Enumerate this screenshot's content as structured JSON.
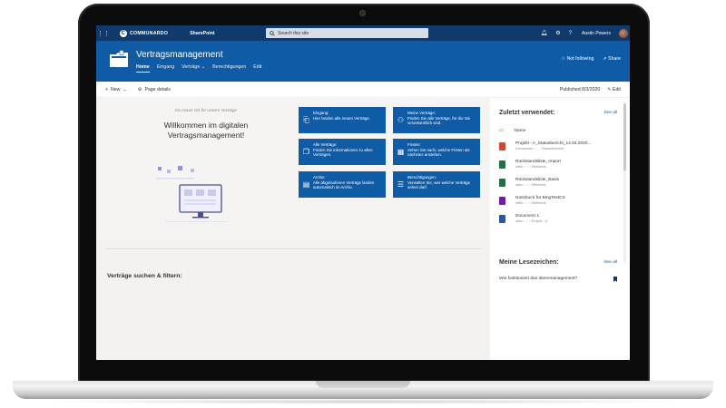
{
  "suitebar": {
    "brand": "COMMUNARDO",
    "product": "SharePoint",
    "search_placeholder": "Search this site",
    "user_name": "Austin Powers",
    "waffle_icon": "waffle-icon",
    "bell_icon": "bell-icon",
    "gear_icon": "gear-icon",
    "help_icon": "help-icon"
  },
  "site": {
    "title": "Vertragsmanagement",
    "nav": [
      {
        "label": "Home",
        "active": true
      },
      {
        "label": "Eingang",
        "active": false
      },
      {
        "label": "Verträge",
        "active": false,
        "dropdown": true
      },
      {
        "label": "Berechtigungen",
        "active": false
      },
      {
        "label": "Edit",
        "active": false
      }
    ],
    "not_following": "Not following",
    "share": "Share"
  },
  "commandbar": {
    "new_label": "New",
    "page_details": "Page details",
    "published": "Published 8/3/2020",
    "edit": "Edit"
  },
  "hero": {
    "subtitle": "Ein neuer Ort für unsere Verträge",
    "title": "Willkommen im digitalen Vertragsmanagement!"
  },
  "tiles": [
    {
      "icon": "inbox-icon",
      "title": "Eingang:",
      "text": "Hier landen alle neuen Verträge."
    },
    {
      "icon": "person-icon",
      "title": "Meine Verträge:",
      "text": "Finden Sie alle Verträge, für die Sie verantwortlich sind."
    },
    {
      "icon": "documents-icon",
      "title": "Alle Verträge:",
      "text": "Finden Sie Informationen zu allen Verträgen."
    },
    {
      "icon": "calendar-icon",
      "title": "Fristen:",
      "text": "Sehen Sie nach, welche Fristen als nächstes anstehen."
    },
    {
      "icon": "archive-icon",
      "title": "Archiv:",
      "text": "Alle abgelaufenen Verträge landen automatisch im Archiv."
    },
    {
      "icon": "permissions-icon",
      "title": "Berechtigungen:",
      "text": "Verwalten Sie, wer welche Verträge sehen darf."
    }
  ],
  "filter": {
    "title": "Verträge suchen & filtern:"
  },
  "recent": {
    "title": "Zuletzt verwendet:",
    "see_all": "See all",
    "column_name": "Name",
    "files": [
      {
        "name": "Projekt - A_Statusbericht_14.04.2020...",
        "path": "Documents › ... › Statusberichte",
        "color": "#d04a2b"
      },
      {
        "name": "Rückstandsliste_Import",
        "path": "sites › ... › Sitefeeds",
        "color": "#1e7145"
      },
      {
        "name": "Rückstandsliste_Basis",
        "path": "sites › ... › Sitefeeds",
        "color": "#1e7145"
      },
      {
        "name": "Notizbuch für BingTestCS",
        "path": "sites › ... › Sitefeeds",
        "color": "#7719aa"
      },
      {
        "name": "Document 1",
        "path": "sites › ... › Projekt - A",
        "color": "#2b579a"
      }
    ]
  },
  "bookmarks": {
    "title": "Meine Lesezeichen:",
    "see_all": "See all",
    "items": [
      {
        "label": "Wie funktioniert das Ideenmanagement?"
      }
    ]
  },
  "colors": {
    "suitebar": "#0f3a6b",
    "brand_blue": "#0f5ba6",
    "page_bg": "#f3f2f1"
  }
}
